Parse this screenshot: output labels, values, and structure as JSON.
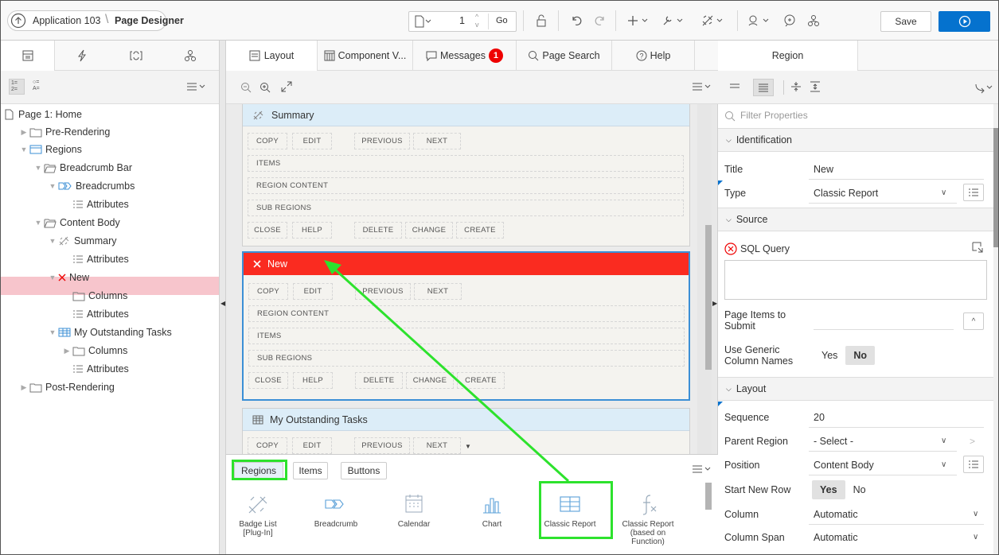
{
  "header": {
    "app_name": "Application 103",
    "page_title": "Page Designer",
    "page_number": "1",
    "go_label": "Go",
    "save_label": "Save"
  },
  "left_pane": {
    "tabs": [
      "rendering-icon",
      "dynamic-actions-icon",
      "processing-icon",
      "shared-components-icon"
    ],
    "tree": [
      {
        "label": "Page 1: Home",
        "icon": "page-icon"
      },
      {
        "label": "Pre-Rendering",
        "icon": "folder-icon"
      },
      {
        "label": "Regions",
        "icon": "regions-icon"
      },
      {
        "label": "Breadcrumb Bar",
        "icon": "folder-open-icon"
      },
      {
        "label": "Breadcrumbs",
        "icon": "breadcrumb-icon"
      },
      {
        "label": "Attributes",
        "icon": "attributes-icon"
      },
      {
        "label": "Content Body",
        "icon": "folder-open-icon"
      },
      {
        "label": "Summary",
        "icon": "badge-list-icon"
      },
      {
        "label": "Attributes",
        "icon": "attributes-icon"
      },
      {
        "label": "New",
        "icon": "error-x-icon"
      },
      {
        "label": "Columns",
        "icon": "folder-icon"
      },
      {
        "label": "Attributes",
        "icon": "attributes-icon"
      },
      {
        "label": "My Outstanding Tasks",
        "icon": "table-icon"
      },
      {
        "label": "Columns",
        "icon": "folder-icon"
      },
      {
        "label": "Attributes",
        "icon": "attributes-icon"
      },
      {
        "label": "Post-Rendering",
        "icon": "folder-icon"
      }
    ]
  },
  "middle_pane": {
    "tabs": {
      "layout": "Layout",
      "component_view": "Component V...",
      "messages": "Messages",
      "messages_count": "1",
      "page_search": "Page Search",
      "help": "Help"
    },
    "regions": [
      {
        "title": "Summary",
        "rows": [
          [
            "COPY",
            "EDIT",
            "PREVIOUS",
            "NEXT"
          ],
          [
            "ITEMS"
          ],
          [
            "REGION CONTENT"
          ],
          [
            "SUB REGIONS"
          ],
          [
            "CLOSE",
            "HELP",
            "DELETE",
            "CHANGE",
            "CREATE"
          ]
        ]
      },
      {
        "title": "New",
        "rows": [
          [
            "COPY",
            "EDIT",
            "PREVIOUS",
            "NEXT"
          ],
          [
            "REGION CONTENT"
          ],
          [
            "ITEMS"
          ],
          [
            "SUB REGIONS"
          ],
          [
            "CLOSE",
            "HELP",
            "DELETE",
            "CHANGE",
            "CREATE"
          ]
        ]
      },
      {
        "title": "My Outstanding Tasks",
        "rows": [
          [
            "COPY",
            "EDIT",
            "PREVIOUS",
            "NEXT"
          ]
        ]
      }
    ],
    "gallery_tabs": [
      "Regions",
      "Items",
      "Buttons"
    ],
    "gallery_items": [
      {
        "label": "Badge List [Plug-In]",
        "icon": "badge-list-icon"
      },
      {
        "label": "Breadcrumb",
        "icon": "breadcrumb-icon"
      },
      {
        "label": "Calendar",
        "icon": "calendar-icon"
      },
      {
        "label": "Chart",
        "icon": "chart-icon"
      },
      {
        "label": "Classic Report",
        "icon": "classic-report-icon"
      },
      {
        "label": "Classic Report (based on Function)",
        "icon": "function-icon"
      }
    ]
  },
  "right_pane": {
    "tab": "Region",
    "filter_placeholder": "Filter Properties",
    "sections": {
      "identification": "Identification",
      "source": "Source",
      "layout": "Layout"
    },
    "properties": {
      "title_label": "Title",
      "title_value": "New",
      "type_label": "Type",
      "type_value": "Classic Report",
      "sql_label": "SQL Query",
      "page_items_label": "Page Items to Submit",
      "generic_label": "Use Generic Column Names",
      "generic_yes": "Yes",
      "generic_no": "No",
      "sequence_label": "Sequence",
      "sequence_value": "20",
      "parent_label": "Parent Region",
      "parent_value": "- Select -",
      "position_label": "Position",
      "position_value": "Content Body",
      "start_row_label": "Start New Row",
      "start_row_yes": "Yes",
      "start_row_no": "No",
      "column_label": "Column",
      "column_value": "Automatic",
      "span_label": "Column Span",
      "span_value": "Automatic"
    }
  },
  "colors": {
    "accent_blue": "#0572ce",
    "error_red": "#fa2b20",
    "selection_pink": "#f7c5cc",
    "annotation_green": "#2de22d"
  }
}
